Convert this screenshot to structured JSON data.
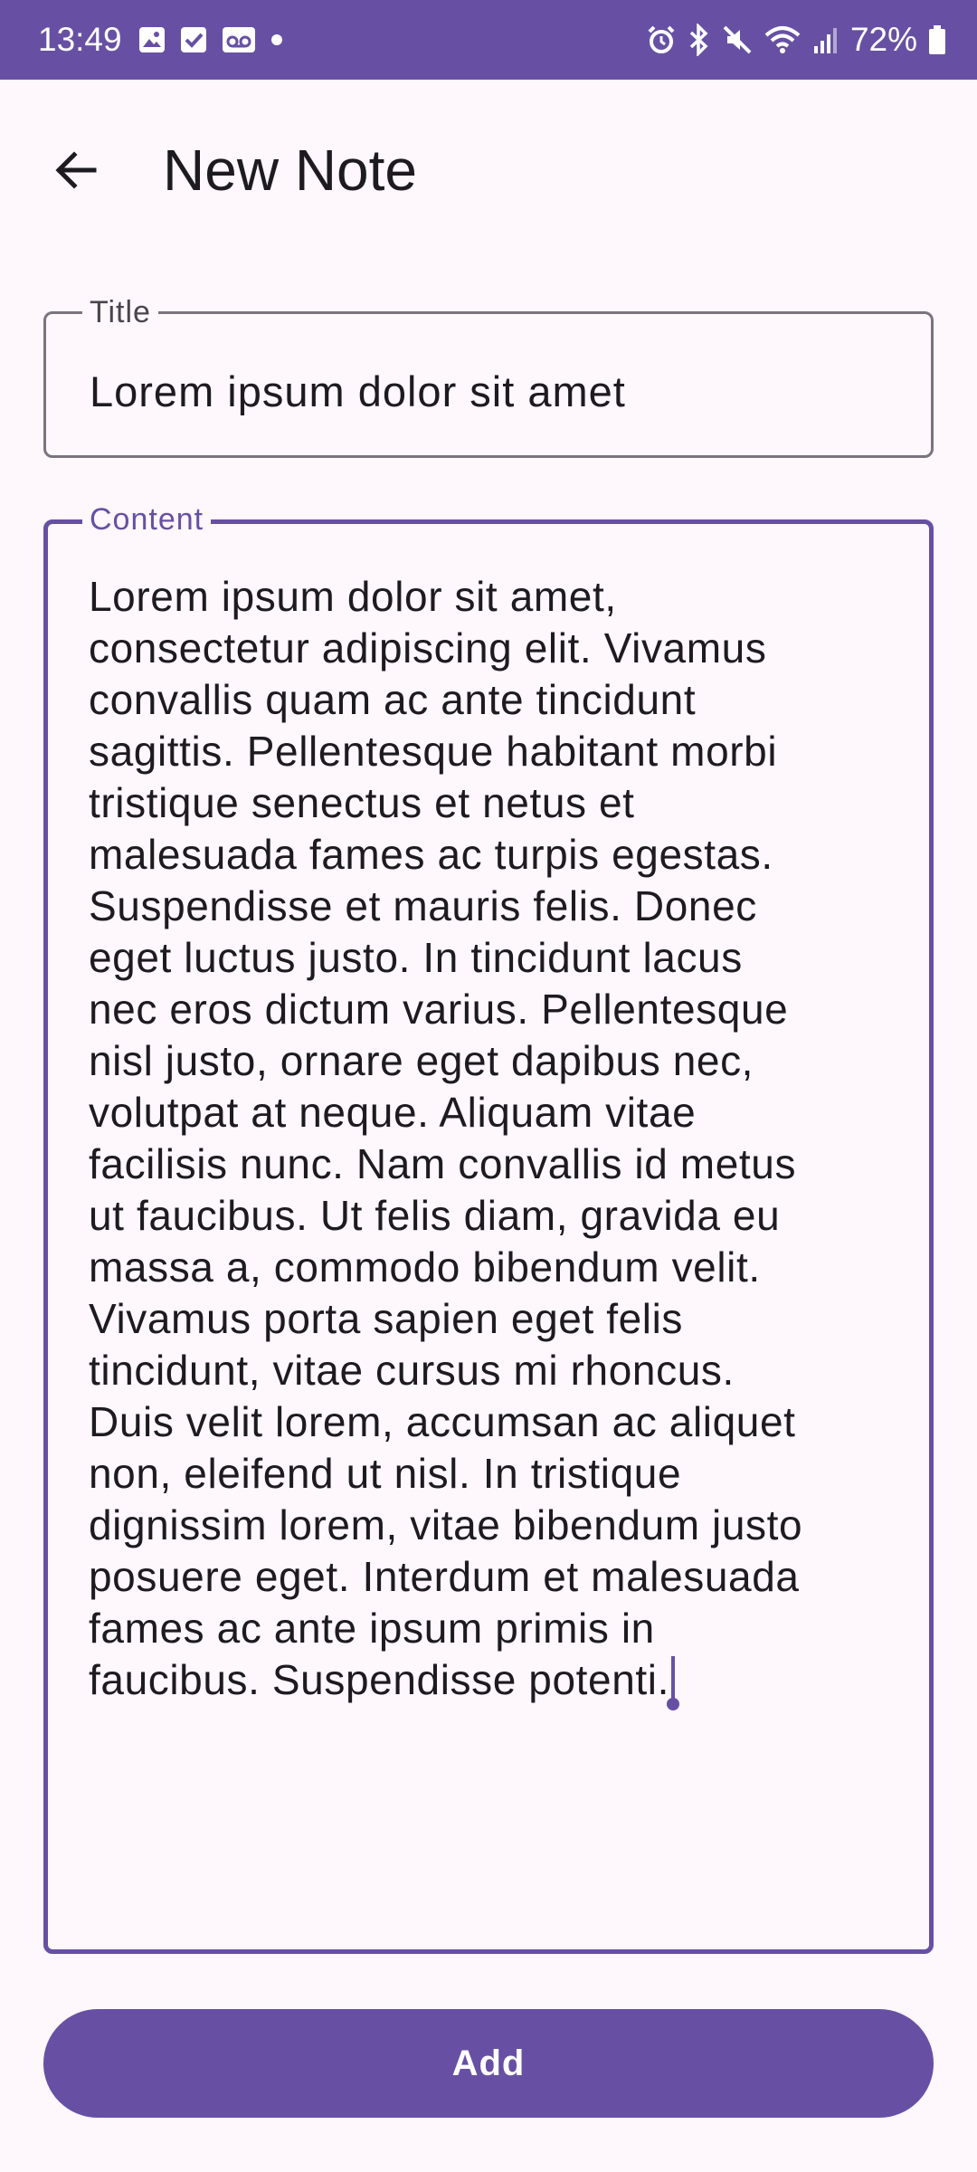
{
  "status_bar": {
    "time": "13:49",
    "battery": "72%",
    "left_icons": [
      "gallery-icon",
      "checkbox-icon",
      "voicemail-icon",
      "dot-icon"
    ],
    "right_icons": [
      "alarm-icon",
      "bluetooth-icon",
      "mute-icon",
      "wifi-icon",
      "signal-icon",
      "battery-icon"
    ],
    "color": "#6750a4"
  },
  "app_bar": {
    "back_icon": "arrow-back-icon",
    "title": "New Note"
  },
  "form": {
    "title_field": {
      "label": "Title",
      "value": "Lorem ipsum dolor sit amet"
    },
    "content_field": {
      "label": "Content",
      "value": "Lorem ipsum dolor sit amet,\nconsectetur adipiscing elit. Vivamus\nconvallis quam ac ante tincidunt\nsagittis. Pellentesque habitant morbi\ntristique senectus et netus et\nmalesuada fames ac turpis egestas.\nSuspendisse et mauris felis. Donec\neget luctus justo. In tincidunt lacus\nnec eros dictum varius. Pellentesque\nnisl justo, ornare eget dapibus nec,\nvolutpat at neque. Aliquam vitae\nfacilisis nunc. Nam convallis id metus\nut faucibus. Ut felis diam, gravida eu\nmassa a, commodo bibendum velit.\nVivamus porta sapien eget felis\ntincidunt, vitae cursus mi rhoncus.\nDuis velit lorem, accumsan ac aliquet\nnon, eleifend ut nisl. In tristique\ndignissim lorem, vitae bibendum justo\nposuere eget. Interdum et malesuada\nfames ac ante ipsum primis in\nfaucibus. Suspendisse potenti.",
      "focused": true
    },
    "add_button_label": "Add"
  },
  "colors": {
    "primary": "#6750a4",
    "background": "#fef7fc",
    "outline": "#79747e",
    "on_surface": "#1d1b20"
  }
}
